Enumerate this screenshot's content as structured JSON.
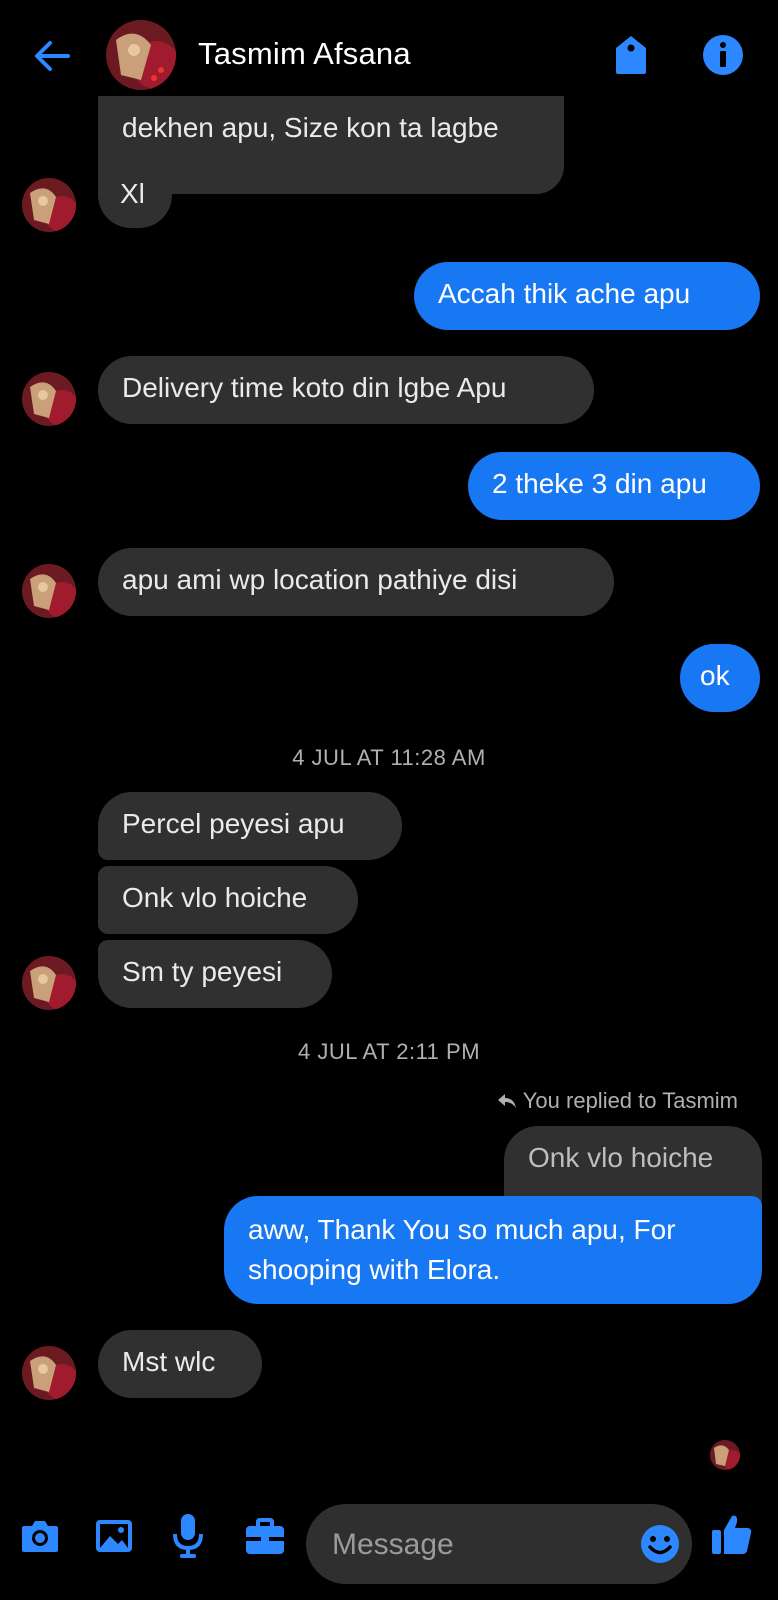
{
  "header": {
    "title": "Tasmim Afsana"
  },
  "messages": {
    "m1": "dekhen apu, Size kon ta lagbe",
    "m2": "Xl",
    "m3": "Accah  thik ache apu",
    "m4": "Delivery time koto din lgbe Apu",
    "m5": "2 theke 3 din apu",
    "m6": "apu ami wp location pathiye disi",
    "m7": "ok",
    "ts1": "4 JUL AT 11:28 AM",
    "m8": "Percel peyesi apu",
    "m9": "Onk vlo hoiche",
    "m10": "Sm ty peyesi",
    "ts2": "4 JUL AT 2:11 PM",
    "reply_note": "You replied to Tasmim",
    "quoted": "Onk vlo hoiche",
    "m11_line1": "aww, Thank You so much apu, For",
    "m11_line2": "shooping with Elora.",
    "m12": "Mst wlc"
  },
  "composer": {
    "placeholder": "Message"
  },
  "colors": {
    "accent": "#1877f2",
    "incoming_bubble": "#303030",
    "background": "#000000"
  },
  "icons": [
    "back-arrow-icon",
    "tag-icon",
    "info-icon",
    "camera-icon",
    "gallery-icon",
    "microphone-icon",
    "briefcase-icon",
    "emoji-icon",
    "thumbs-up-icon"
  ]
}
